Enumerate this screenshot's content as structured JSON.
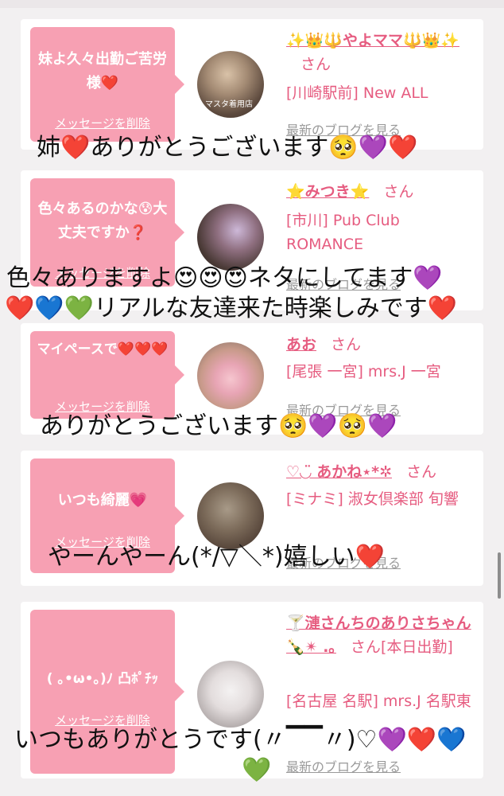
{
  "messages": [
    {
      "bubble": "妹よ久々出勤ご苦労様❤️",
      "delete_label": "メッセージを削除",
      "name": "✨👑🔱やよママ🔱👑✨",
      "honorific": "さん",
      "shop": "[川崎駅前] New ALL",
      "blog_link": "最新のブログを見る",
      "avatar_caption": "マスタ着用店",
      "overlay": "姉❤️ありがとうございます🥺💜❤️"
    },
    {
      "bubble": "色々あるのかな😰大丈夫ですか❓",
      "delete_label": "メッセージを削除",
      "name": "⭐️みつき⭐️",
      "honorific": "さん",
      "shop": "[市川] Pub Club ROMANCE",
      "blog_link": "最新のブログを見る",
      "overlay": "色々ありますよ😍😍😍ネタにしてます💜",
      "overlay2": "❤️💙💚リアルな友達来た時楽しみです❤️"
    },
    {
      "bubble": "マイペースで❤️❤️❤️",
      "delete_label": "メッセージを削除",
      "name": "あお",
      "honorific": "さん",
      "shop": "[尾張 一宮] mrs.J 一宮",
      "blog_link": "最新のブログを見る",
      "overlay": "ありがとうございます🥺💜🥺💜"
    },
    {
      "bubble": "いつも綺麗💗",
      "delete_label": "メッセージを削除",
      "name": "♡◡̈ あかね⋆*✲",
      "honorific": "さん",
      "shop": "[ミナミ] 淑女倶楽部 旬響",
      "blog_link": "最新のブログを見る",
      "overlay": "やーんやーん(*/▽＼*)嬉しい❤️"
    },
    {
      "bubble": "( ｡•ω•｡)ﾉ 凸ﾎﾟﾁｯ",
      "delete_label": "メッセージを削除",
      "name": "🍸漣さんちのありさちゃん🍾✴︎ .｡",
      "honorific": "さん",
      "shop_prefix": "[本日出勤]",
      "shop": "[名古屋 名駅] mrs.J 名駅東",
      "blog_link": "最新のブログを見る",
      "overlay": "いつもありがとうです(〃▔▔〃)♡💜❤️💙",
      "overlay2": "💚"
    }
  ],
  "colors": {
    "bubble": "#f7a0b3",
    "accent_text": "#e65c80",
    "background": "#f2f0f1"
  }
}
